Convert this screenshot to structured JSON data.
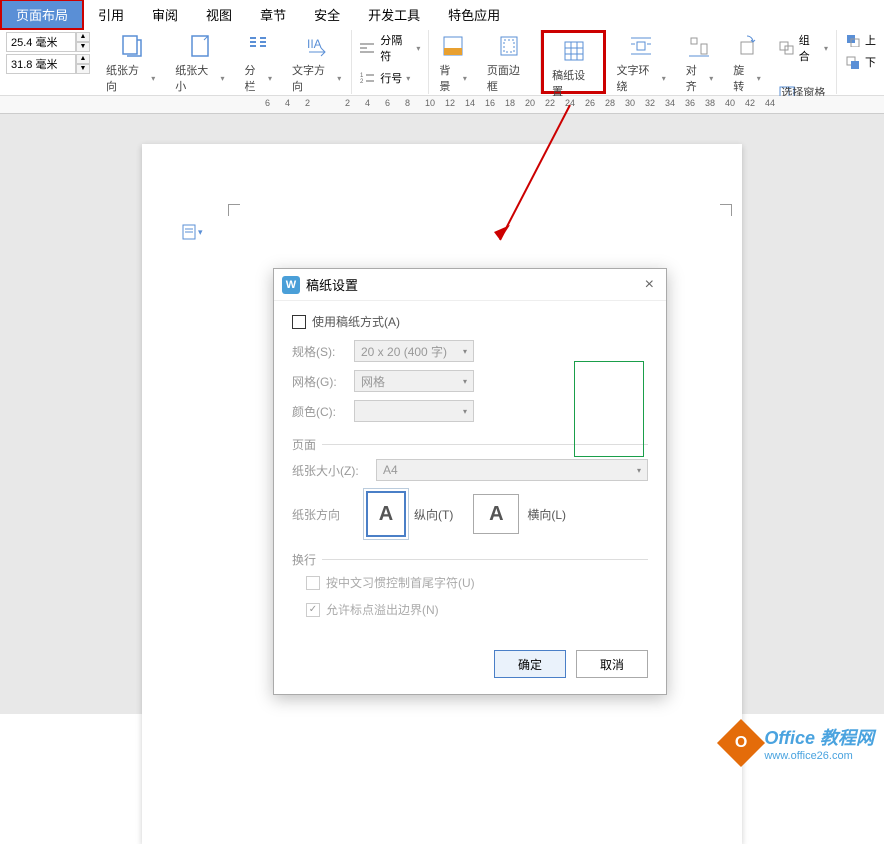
{
  "menu": {
    "items": [
      "页面布局",
      "引用",
      "审阅",
      "视图",
      "章节",
      "安全",
      "开发工具",
      "特色应用"
    ],
    "active_index": 0
  },
  "sizes": {
    "width": "25.4 毫米",
    "height": "31.8 毫米"
  },
  "toolbar": {
    "paper_orientation": "纸张方向",
    "paper_size": "纸张大小",
    "columns": "分栏",
    "text_direction": "文字方向",
    "separator": "分隔符",
    "line_number": "行号",
    "background": "背景",
    "page_border": "页面边框",
    "grid_setting": "稿纸设置",
    "text_wrap": "文字环绕",
    "align": "对齐",
    "rotate": "旋转",
    "selection_pane": "选择窗格",
    "group": "组合",
    "up": "上",
    "down": "下"
  },
  "ruler": [
    "6",
    "4",
    "2",
    "",
    "2",
    "4",
    "6",
    "8",
    "10",
    "12",
    "14",
    "16",
    "18",
    "20",
    "22",
    "24",
    "26",
    "28",
    "30",
    "32",
    "34",
    "36",
    "38",
    "40",
    "42",
    "44"
  ],
  "dialog": {
    "title": "稿纸设置",
    "use_grid_label": "使用稿纸方式(A)",
    "spec_label": "规格(S):",
    "spec_value": "20 x 20 (400 字)",
    "grid_label": "网格(G):",
    "grid_value": "网格",
    "color_label": "颜色(C):",
    "page_section": "页面",
    "paper_size_label": "纸张大小(Z):",
    "paper_size_value": "A4",
    "orientation_label": "纸张方向",
    "portrait_label": "纵向(T)",
    "landscape_label": "横向(L)",
    "wrap_section": "换行",
    "cjk_control_label": "按中文习惯控制首尾字符(U)",
    "allow_overflow_label": "允许标点溢出边界(N)",
    "ok": "确定",
    "cancel": "取消"
  },
  "watermark": {
    "brand": "Office 教程网",
    "url": "www.office26.com"
  }
}
